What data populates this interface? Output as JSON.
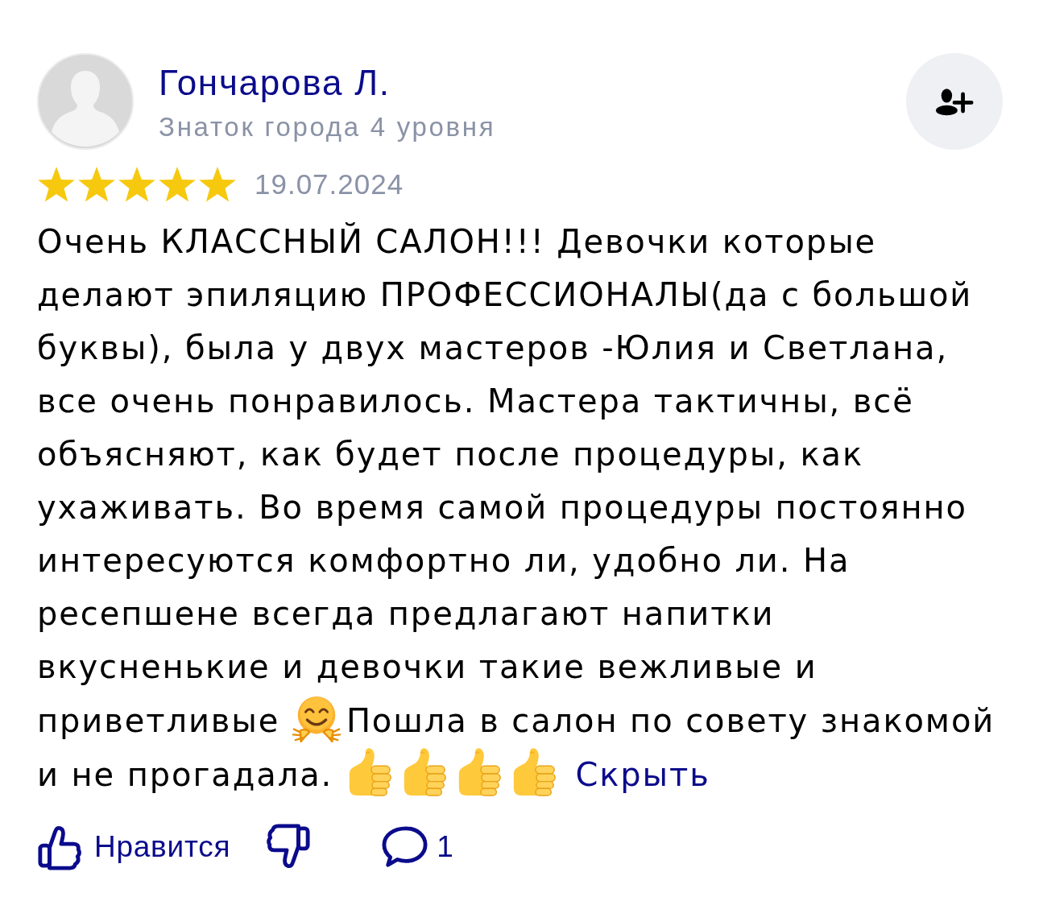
{
  "author": {
    "name": "Гончарова Л.",
    "subtitle": "Знаток города 4 уровня"
  },
  "review": {
    "stars": 5,
    "date": "19.07.2024",
    "body": [
      {
        "kind": "text",
        "text": "Очень КЛАССНЫЙ САЛОН!!! Девочки которые делают эпиляцию ПРОФЕССИОНАЛЫ(да с большой буквы), была у двух мастеров -Юлия и Светлана, все очень понравилось. Мастера тактичны, всё объясняют, как будет после процедуры, как ухаживать. Во время самой процедуры постоянно интересуются комфортно ли, удобно ли. На ресепшене всегда предлагают напитки вкусненькие и девочки такие вежливые и приветливые"
      },
      {
        "kind": "hug_emoji"
      },
      {
        "kind": "text",
        "text": "Пошла в салон по совету знакомой и не прогадала."
      },
      {
        "kind": "thumbs_up_emoji"
      },
      {
        "kind": "thumbs_up_emoji"
      },
      {
        "kind": "thumbs_up_emoji"
      },
      {
        "kind": "thumbs_up_emoji"
      }
    ],
    "collapse_link": "Скрыть"
  },
  "actions": {
    "like_label": "Нравится",
    "comments_count": "1"
  }
}
